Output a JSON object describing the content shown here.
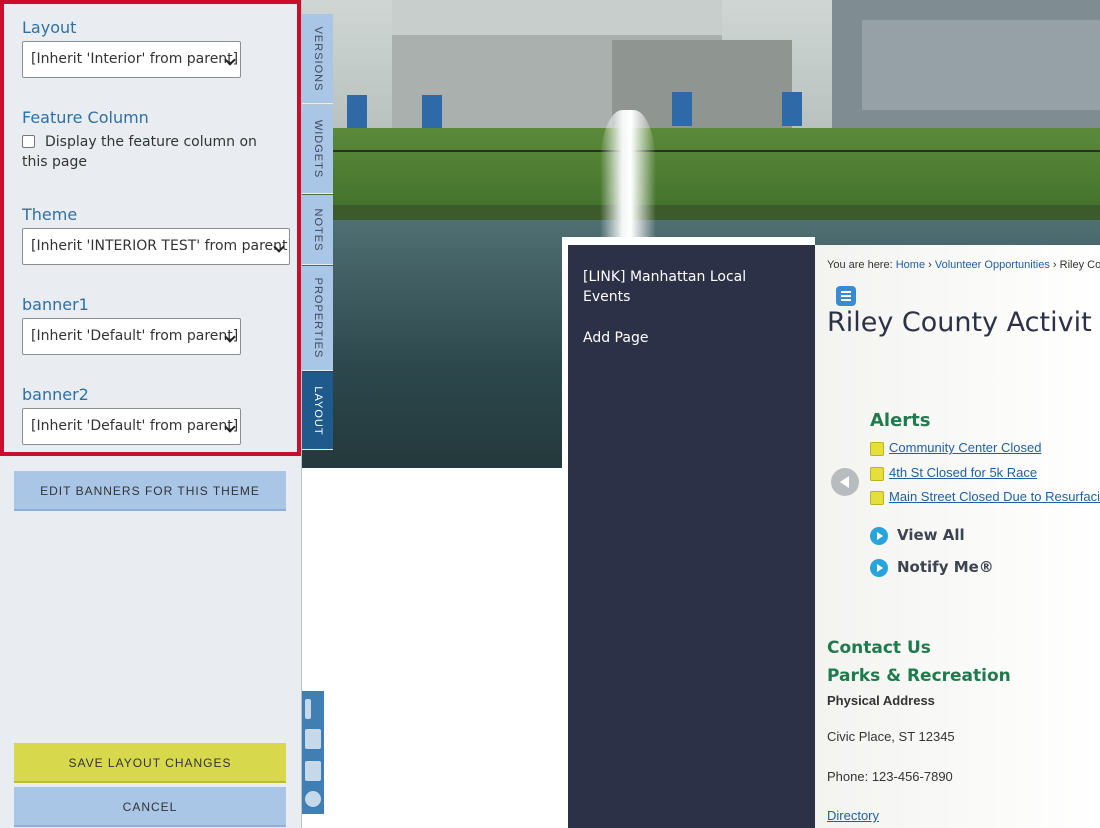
{
  "panel": {
    "layout_label": "Layout",
    "layout_value": "[Inherit 'Interior' from parent]",
    "feature_column_label": "Feature Column",
    "feature_column_checkbox": "Display the feature column on this page",
    "theme_label": "Theme",
    "theme_value": "[Inherit 'INTERIOR TEST' from parent]",
    "banner1_label": "banner1",
    "banner1_value": "[Inherit 'Default' from parent]",
    "banner2_label": "banner2",
    "banner2_value": "[Inherit 'Default' from parent]",
    "edit_banners_button": "EDIT BANNERS FOR THIS THEME",
    "save_button": "SAVE LAYOUT CHANGES",
    "cancel_button": "CANCEL"
  },
  "tabs": [
    {
      "label": "VERSIONS",
      "active": false
    },
    {
      "label": "WIDGETS",
      "active": false
    },
    {
      "label": "NOTES",
      "active": false
    },
    {
      "label": "PROPERTIES",
      "active": false
    },
    {
      "label": "LAYOUT",
      "active": true
    }
  ],
  "nav": {
    "item1": "[LINK] Manhattan Local Events",
    "item2": "Add Page"
  },
  "content": {
    "breadcrumb_prefix": "You are here:",
    "breadcrumb_home": "Home",
    "breadcrumb_sep": "›",
    "breadcrumb_volunteer": "Volunteer Opportunities",
    "breadcrumb_current": "Riley Co",
    "heading": "Riley County Activit",
    "alerts_title": "Alerts",
    "alerts": [
      "Community Center Closed",
      "4th St Closed for 5k Race",
      "Main Street Closed Due to Resurfaci"
    ],
    "view_all": "View All",
    "notify_me": "Notify Me®",
    "contact_title": "Contact Us",
    "dept_title": "Parks & Recreation",
    "address_label": "Physical Address",
    "address_value": "Civic Place, ST 12345",
    "phone": "Phone: 123-456-7890",
    "directory_link": "Directory"
  },
  "colors": {
    "highlight_border": "#c8102e",
    "tab_active": "#1e5a8c",
    "tab_inactive": "#a9c6e7",
    "save_button": "#d8d84c",
    "nav_bg": "#2c3148",
    "green_heading": "#1f7a4d"
  }
}
